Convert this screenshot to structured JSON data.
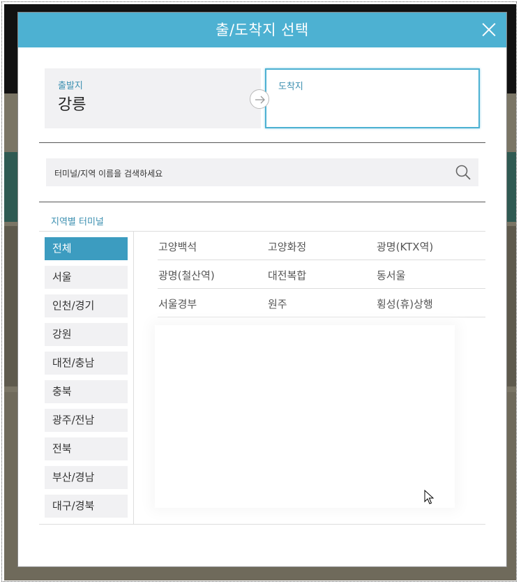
{
  "modal": {
    "title": "출/도착지 선택",
    "close_icon": "close-icon"
  },
  "origin": {
    "label": "출발지",
    "value": "강릉"
  },
  "destination": {
    "label": "도착지",
    "value": ""
  },
  "search": {
    "placeholder": "터미널/지역 이름을 검색하세요",
    "icon": "search-icon"
  },
  "region_section_title": "지역별 터미널",
  "regions": [
    {
      "label": "전체",
      "selected": true
    },
    {
      "label": "서울"
    },
    {
      "label": "인천/경기"
    },
    {
      "label": "강원"
    },
    {
      "label": "대전/충남"
    },
    {
      "label": "충북"
    },
    {
      "label": "광주/전남"
    },
    {
      "label": "전북"
    },
    {
      "label": "부산/경남"
    },
    {
      "label": "대구/경북"
    }
  ],
  "terminals": [
    [
      "고양백석",
      "고양화정",
      "광명(KTX역)"
    ],
    [
      "광명(철산역)",
      "대전복합",
      "동서울"
    ],
    [
      "서울경부",
      "원주",
      "횡성(휴)상행"
    ]
  ],
  "colors": {
    "accent": "#4db1d2",
    "selected": "#3c9cc0",
    "label": "#3b8fb0"
  }
}
